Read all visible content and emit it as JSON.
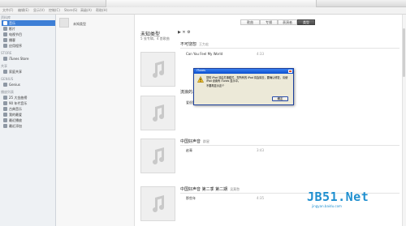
{
  "menubar": {
    "items": [
      "文件(F)",
      "编辑(E)",
      "显示(V)",
      "控制(C)",
      "Store(S)",
      "高级(A)",
      "帮助(H)"
    ]
  },
  "sidebar": {
    "sections": [
      {
        "label": "资料库",
        "items": [
          {
            "label": "音乐",
            "icon": "music-icon",
            "selected": true
          },
          {
            "label": "影片",
            "icon": "movie-icon",
            "selected": false
          },
          {
            "label": "电视节目",
            "icon": "tv-icon",
            "selected": false
          },
          {
            "label": "播客",
            "icon": "podcast-icon",
            "selected": false
          },
          {
            "label": "应用程序",
            "icon": "apps-icon",
            "selected": false
          }
        ]
      },
      {
        "label": "STORE",
        "items": [
          {
            "label": "iTunes Store",
            "icon": "store-icon",
            "selected": false
          }
        ]
      },
      {
        "label": "共享",
        "items": [
          {
            "label": "家庭共享",
            "icon": "home-icon",
            "selected": false
          }
        ]
      },
      {
        "label": "GENIUS",
        "items": [
          {
            "label": "Genius",
            "icon": "genius-icon",
            "selected": false
          }
        ]
      },
      {
        "label": "播放列表",
        "items": [
          {
            "label": "25 大金曲榜",
            "icon": "playlist-icon",
            "selected": false
          },
          {
            "label": "90 年代音乐",
            "icon": "playlist-icon",
            "selected": false
          },
          {
            "label": "古典音乐",
            "icon": "playlist-icon",
            "selected": false
          },
          {
            "label": "我的最爱",
            "icon": "playlist-icon",
            "selected": false
          },
          {
            "label": "最近播放",
            "icon": "playlist-icon",
            "selected": false
          },
          {
            "label": "最近添加",
            "icon": "playlist-icon",
            "selected": false
          }
        ]
      }
    ]
  },
  "column2": {
    "album": "未知类型"
  },
  "view_tabs": [
    "歌曲",
    "专辑",
    "表演者",
    "类型"
  ],
  "view_tabs_selected": 3,
  "header": {
    "title": "未知类型",
    "controls": "▶ ✕ ⚙",
    "subtitle": "5 张专辑，4 首歌曲"
  },
  "albums": [
    {
      "title": "不可饶恕",
      "artist": "王力宏",
      "tracks": [
        {
          "name": "Can You Feel My World",
          "duration": "4:33"
        }
      ]
    },
    {
      "title": "流浪的…",
      "artist": "",
      "tracks": [
        {
          "name": "爱很简单",
          "duration": "4:26"
        }
      ]
    },
    {
      "title": "中国好声音",
      "artist": "群星",
      "tracks": [
        {
          "name": "赵青",
          "duration": "3:43"
        }
      ]
    },
    {
      "title": "中国好声音 第二季 第二期",
      "artist": "吴莫愁",
      "tracks": [
        {
          "name": "那些年",
          "duration": "4:35"
        }
      ]
    }
  ],
  "dialog": {
    "title": "iTunes",
    "message": "您的 iPod 将由打通模式，您所有的 iPod 将会除去，要确认修复，请使 iPod 设置有 iTunes 显示中。",
    "hint": "不要再显示这个",
    "ok_label": "确定"
  },
  "watermark": {
    "main": "JB51.Net",
    "sub": "jingyan.baidu.com",
    "color": "#1f8fcf"
  },
  "colors": {
    "accent": "#3d7fd6",
    "dialog_title": "#0b4fcf"
  }
}
